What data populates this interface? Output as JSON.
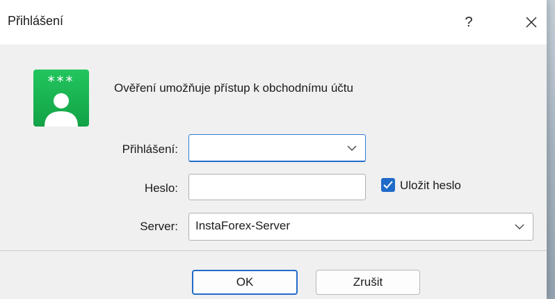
{
  "dialog": {
    "title": "Přihlášení",
    "help_glyph": "?",
    "intro_text": "Ověření umožňuje přístup k obchodnímu účtu",
    "icon_text": "***"
  },
  "form": {
    "login_label": "Přihlášení:",
    "login_value": "",
    "password_label": "Heslo:",
    "password_value": "",
    "save_password_label": "Uložit heslo",
    "save_password_checked": true,
    "server_label": "Server:",
    "server_value": "InstaForex-Server"
  },
  "buttons": {
    "ok_label": "OK",
    "cancel_label": "Zrušit"
  },
  "colors": {
    "accent": "#1f6bc9",
    "icon_green": "#1fb955",
    "title_bar": "#ffffff",
    "dialog_bg": "#f0f0f0"
  },
  "icons": {
    "help": "question-icon",
    "close": "close-icon",
    "app": "account-user-icon",
    "dropdown": "chevron-down-icon",
    "check": "checkmark-icon"
  }
}
